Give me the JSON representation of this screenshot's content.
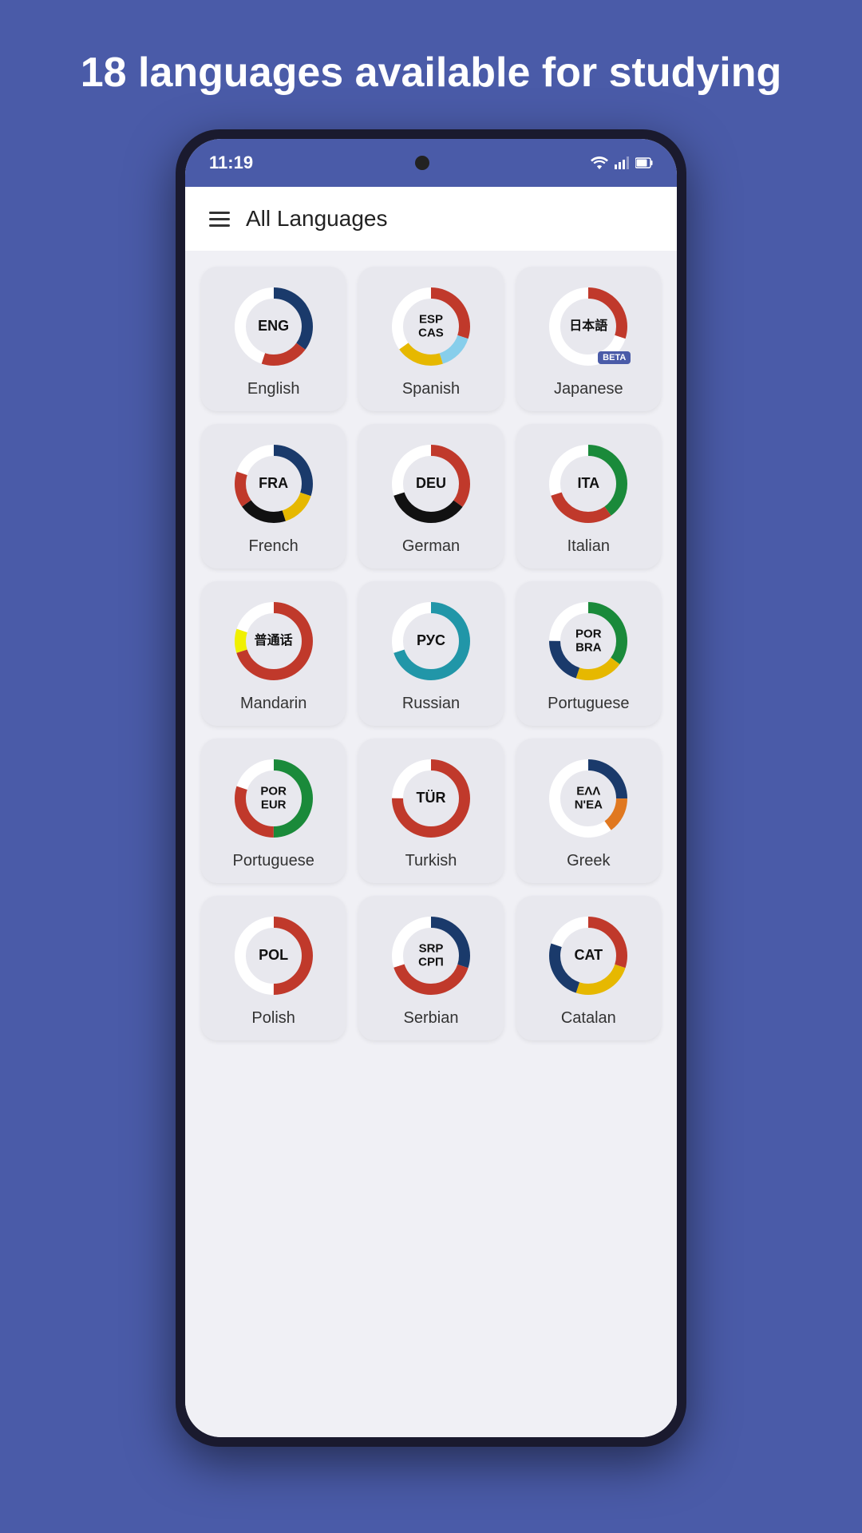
{
  "header": {
    "title": "18 languages available for studying"
  },
  "status_bar": {
    "time": "11:19"
  },
  "app_bar": {
    "title": "All Languages"
  },
  "languages": [
    {
      "code": "ENG",
      "label": "English",
      "beta": false,
      "segments": [
        {
          "color": "#1a3a6b",
          "pct": 35
        },
        {
          "color": "#c0392b",
          "pct": 20
        },
        {
          "color": "#ffffff",
          "pct": 45
        }
      ]
    },
    {
      "code": "ESP\nCAS",
      "label": "Spanish",
      "beta": false,
      "segments": [
        {
          "color": "#c0392b",
          "pct": 30
        },
        {
          "color": "#87ceeb",
          "pct": 15
        },
        {
          "color": "#e6b800",
          "pct": 20
        },
        {
          "color": "#ffffff",
          "pct": 35
        }
      ]
    },
    {
      "code": "日本語",
      "label": "Japanese",
      "beta": true,
      "segments": [
        {
          "color": "#c0392b",
          "pct": 30
        },
        {
          "color": "#ffffff",
          "pct": 70
        }
      ]
    },
    {
      "code": "FRA",
      "label": "French",
      "beta": false,
      "segments": [
        {
          "color": "#1a3a6b",
          "pct": 30
        },
        {
          "color": "#e6b800",
          "pct": 15
        },
        {
          "color": "#111111",
          "pct": 20
        },
        {
          "color": "#c0392b",
          "pct": 15
        },
        {
          "color": "#ffffff",
          "pct": 20
        }
      ]
    },
    {
      "code": "DEU",
      "label": "German",
      "beta": false,
      "segments": [
        {
          "color": "#c0392b",
          "pct": 35
        },
        {
          "color": "#111111",
          "pct": 35
        },
        {
          "color": "#ffffff",
          "pct": 30
        }
      ]
    },
    {
      "code": "ITA",
      "label": "Italian",
      "beta": false,
      "segments": [
        {
          "color": "#1a8a3a",
          "pct": 40
        },
        {
          "color": "#c0392b",
          "pct": 30
        },
        {
          "color": "#ffffff",
          "pct": 30
        }
      ]
    },
    {
      "code": "普通话",
      "label": "Mandarin",
      "beta": false,
      "segments": [
        {
          "color": "#c0392b",
          "pct": 70
        },
        {
          "color": "#f0f000",
          "pct": 10
        },
        {
          "color": "#ffffff",
          "pct": 20
        }
      ]
    },
    {
      "code": "РУС",
      "label": "Russian",
      "beta": false,
      "segments": [
        {
          "color": "#2196a8",
          "pct": 70
        },
        {
          "color": "#ffffff",
          "pct": 30
        }
      ]
    },
    {
      "code": "POR\nBRA",
      "label": "Portuguese",
      "beta": false,
      "segments": [
        {
          "color": "#1a8a3a",
          "pct": 35
        },
        {
          "color": "#e6b800",
          "pct": 20
        },
        {
          "color": "#1a3a6b",
          "pct": 20
        },
        {
          "color": "#ffffff",
          "pct": 25
        }
      ]
    },
    {
      "code": "POR\nEUR",
      "label": "Portuguese",
      "beta": false,
      "segments": [
        {
          "color": "#1a8a3a",
          "pct": 50
        },
        {
          "color": "#c0392b",
          "pct": 30
        },
        {
          "color": "#ffffff",
          "pct": 20
        }
      ]
    },
    {
      "code": "TÜR",
      "label": "Turkish",
      "beta": false,
      "segments": [
        {
          "color": "#c0392b",
          "pct": 75
        },
        {
          "color": "#ffffff",
          "pct": 25
        }
      ]
    },
    {
      "code": "ΕΛΛ\nΝ'ΕΑ",
      "label": "Greek",
      "beta": false,
      "segments": [
        {
          "color": "#1a3a6b",
          "pct": 25
        },
        {
          "color": "#e07820",
          "pct": 15
        },
        {
          "color": "#ffffff",
          "pct": 60
        }
      ]
    },
    {
      "code": "POL",
      "label": "Polish",
      "beta": false,
      "segments": [
        {
          "color": "#c0392b",
          "pct": 50
        },
        {
          "color": "#ffffff",
          "pct": 50
        }
      ]
    },
    {
      "code": "SRP\nСРП",
      "label": "Serbian",
      "beta": false,
      "segments": [
        {
          "color": "#1a3a6b",
          "pct": 30
        },
        {
          "color": "#c0392b",
          "pct": 40
        },
        {
          "color": "#ffffff",
          "pct": 30
        }
      ]
    },
    {
      "code": "CAT",
      "label": "Catalan",
      "beta": false,
      "segments": [
        {
          "color": "#c0392b",
          "pct": 30
        },
        {
          "color": "#e6b800",
          "pct": 25
        },
        {
          "color": "#1a3a6b",
          "pct": 25
        },
        {
          "color": "#ffffff",
          "pct": 20
        }
      ]
    }
  ]
}
